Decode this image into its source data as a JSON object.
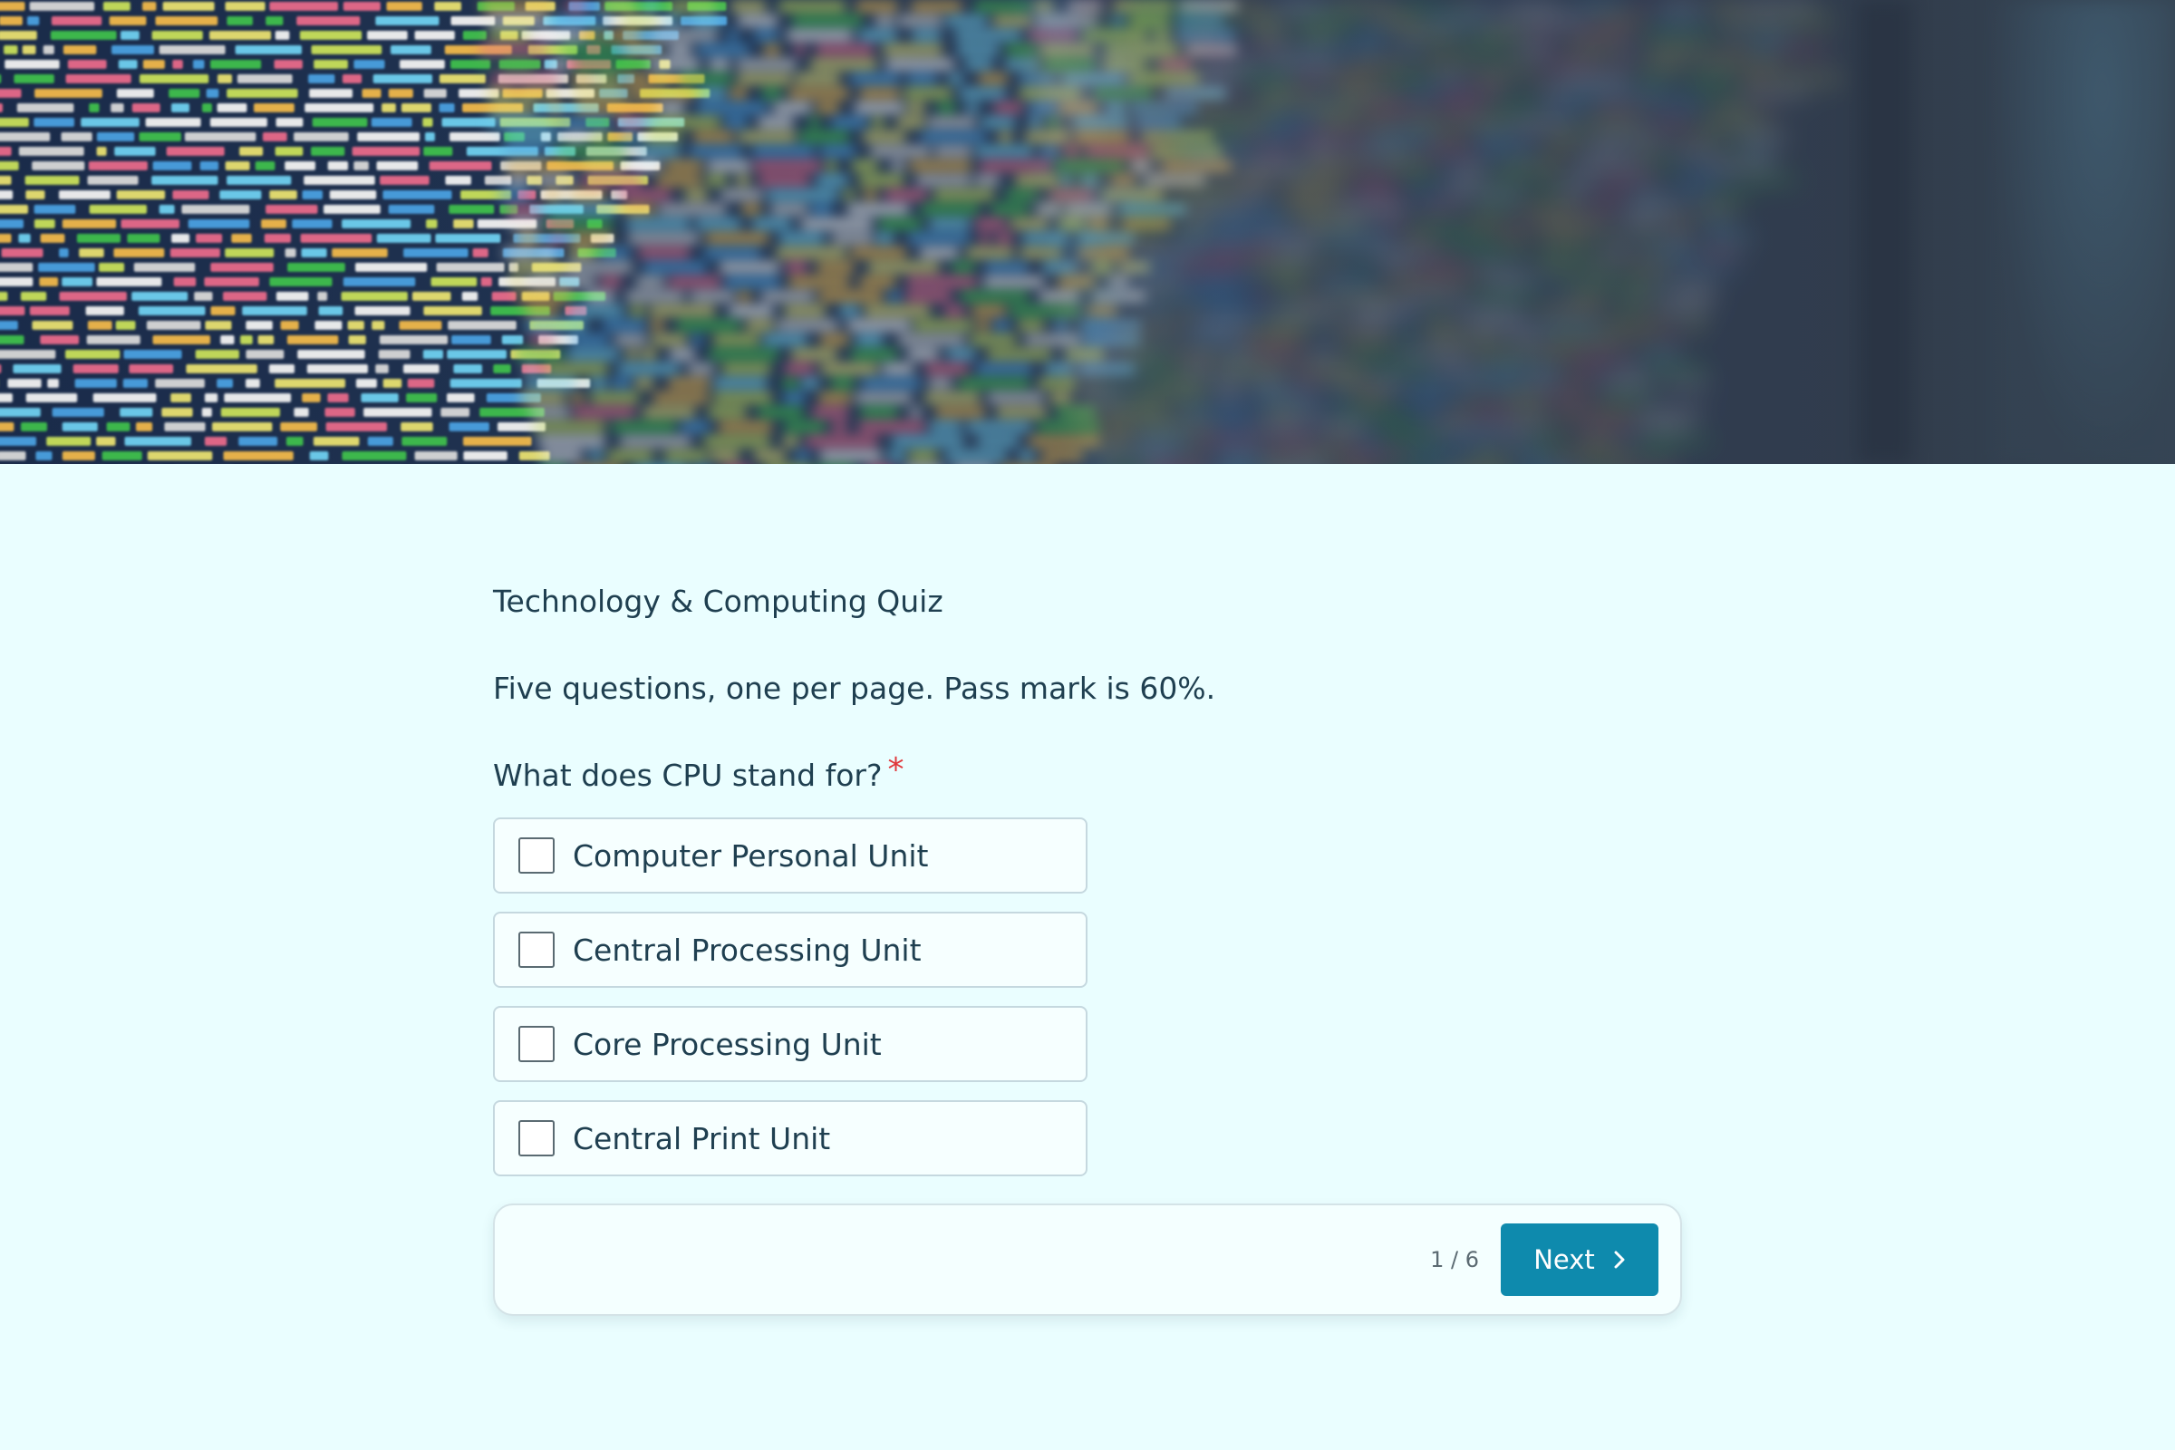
{
  "quiz": {
    "title": "Technology & Computing Quiz",
    "description": "Five questions, one per page. Pass mark is 60%."
  },
  "question": {
    "text": "What does CPU stand for?",
    "required_marker": "*",
    "options": [
      {
        "label": "Computer Personal Unit",
        "checked": false
      },
      {
        "label": "Central Processing Unit",
        "checked": false
      },
      {
        "label": "Core Processing Unit",
        "checked": false
      },
      {
        "label": "Central Print Unit",
        "checked": false
      }
    ]
  },
  "navigation": {
    "page_indicator": "1 / 6",
    "next_label": "Next",
    "next_icon": "chevron-right-icon"
  },
  "colors": {
    "background": "#eafeff",
    "accent": "#0e8aad",
    "required": "#e0383b",
    "text": "#1f3f50"
  },
  "hero": {
    "image": "blurred-source-code-screen"
  }
}
